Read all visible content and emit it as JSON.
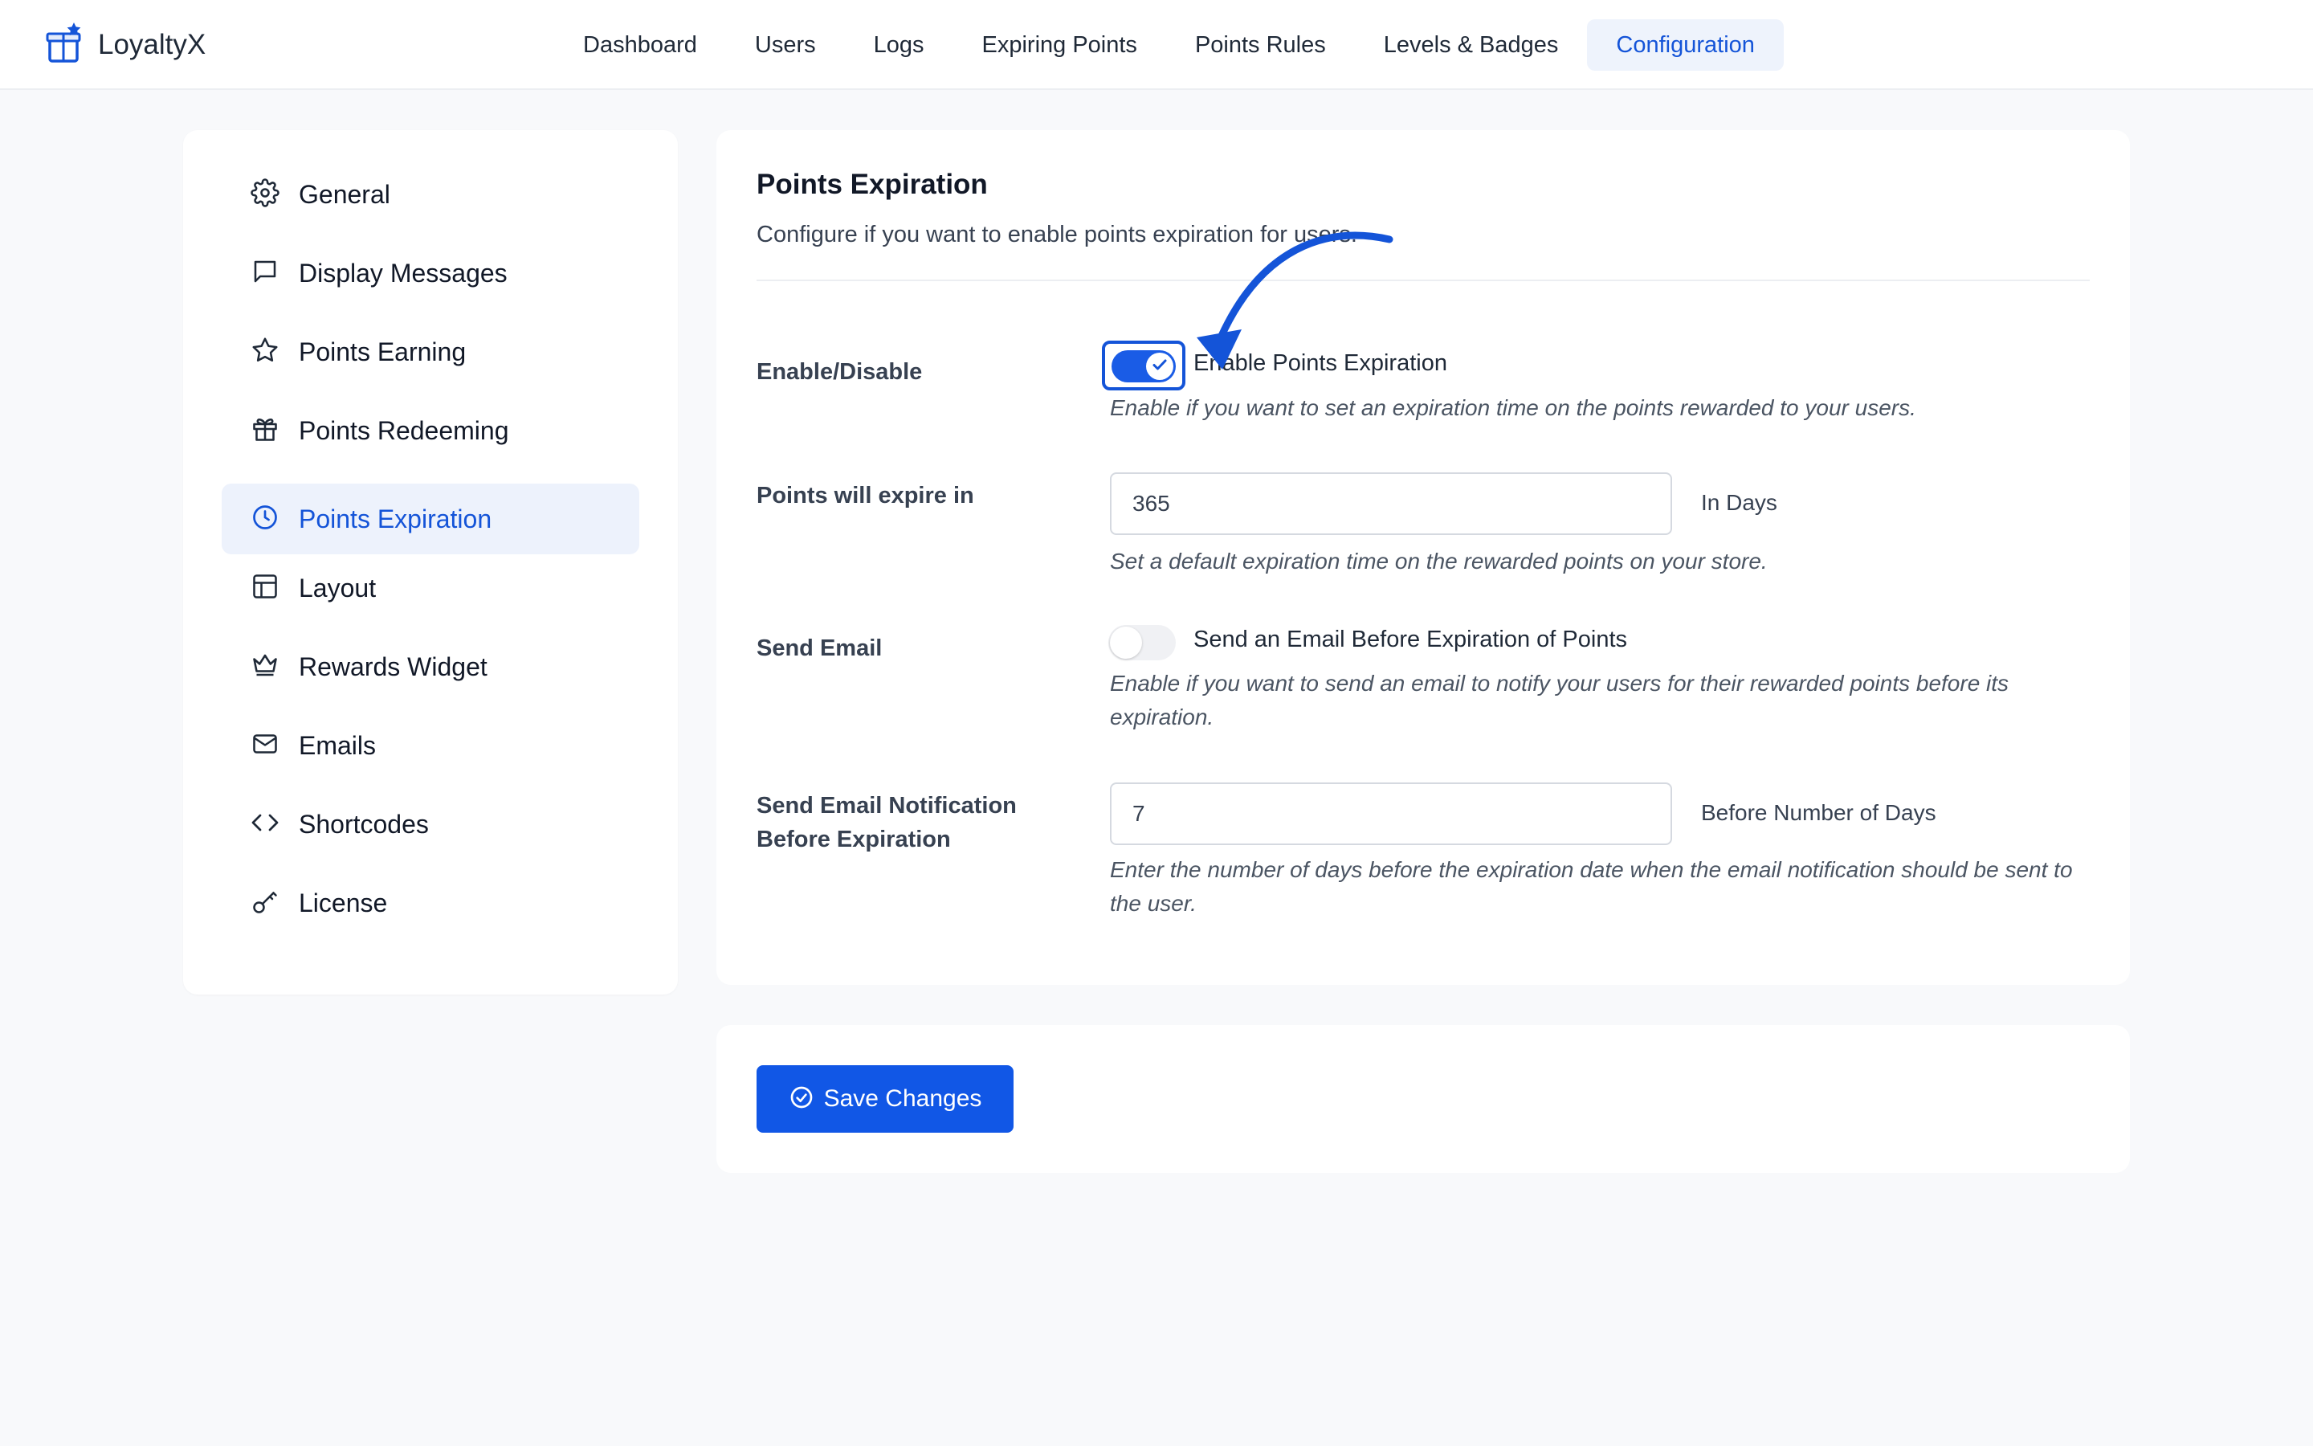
{
  "app": {
    "name": "LoyaltyX",
    "brand_color": "#1454d8"
  },
  "nav": {
    "items": [
      {
        "label": "Dashboard"
      },
      {
        "label": "Users"
      },
      {
        "label": "Logs"
      },
      {
        "label": "Expiring Points"
      },
      {
        "label": "Points Rules"
      },
      {
        "label": "Levels & Badges"
      },
      {
        "label": "Configuration"
      }
    ],
    "active": "Configuration"
  },
  "sidebar": {
    "items": [
      {
        "label": "General",
        "icon": "gear-icon"
      },
      {
        "label": "Display Messages",
        "icon": "message-icon"
      },
      {
        "label": "Points Earning",
        "icon": "star-icon"
      },
      {
        "label": "Points Redeeming",
        "icon": "gift-icon"
      },
      {
        "label": "Points Expiration",
        "icon": "clock-icon"
      },
      {
        "label": "Layout",
        "icon": "layout-icon"
      },
      {
        "label": "Rewards Widget",
        "icon": "crown-icon"
      },
      {
        "label": "Emails",
        "icon": "mail-icon"
      },
      {
        "label": "Shortcodes",
        "icon": "code-icon"
      },
      {
        "label": "License",
        "icon": "key-icon"
      }
    ],
    "active": "Points Expiration"
  },
  "panel": {
    "title": "Points Expiration",
    "description": "Configure if you want to enable points expiration for users.",
    "rows": {
      "enable": {
        "label": "Enable/Disable",
        "toggle_label": "Enable Points Expiration",
        "toggle_on": true,
        "help": "Enable if you want to set an expiration time on the points rewarded to your users."
      },
      "expire_in": {
        "label": "Points will expire in",
        "value": "365",
        "unit": "In Days",
        "help": "Set a default expiration time on the rewarded points on your store."
      },
      "send_email": {
        "label": "Send Email",
        "toggle_label": "Send an Email Before Expiration of Points",
        "toggle_on": false,
        "help": "Enable if you want to send an email to notify your users for their rewarded points before its expiration."
      },
      "notify_before": {
        "label_line1": "Send Email Notification",
        "label_line2": "Before Expiration",
        "value": "7",
        "unit": "Before Number of Days",
        "help": "Enter the number of days before the expiration date when the email notification should be sent to the user."
      }
    }
  },
  "save": {
    "label": "Save Changes",
    "color": "#1157e6"
  }
}
